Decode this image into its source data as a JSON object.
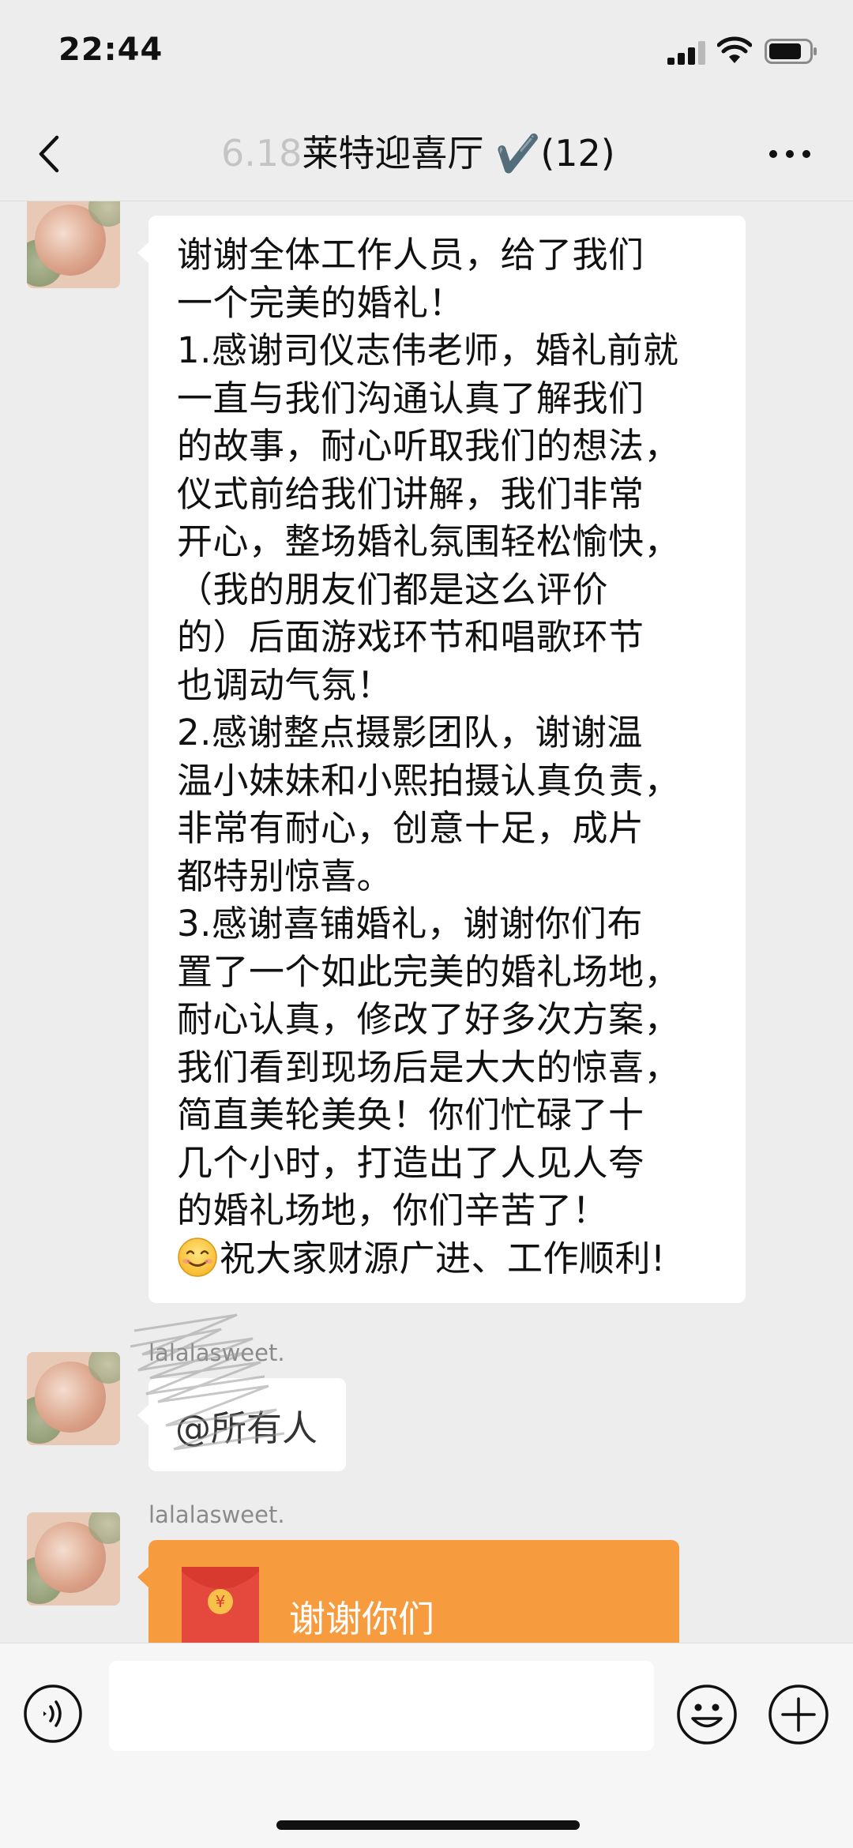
{
  "status_bar": {
    "time": "22:44"
  },
  "header": {
    "title_prefix": "6.18",
    "title_main": "莱特迎喜厅 ✔️(12)",
    "back_icon": "chevron-left-icon",
    "more_icon": "more-dots-icon"
  },
  "messages": [
    {
      "type": "text",
      "lines": [
        "谢谢全体工作人员，给了我们",
        "一个完美的婚礼！",
        "1.感谢司仪志伟老师，婚礼前就",
        "一直与我们沟通认真了解我们",
        "的故事，耐心听取我们的想法，",
        "仪式前给我们讲解，我们非常",
        "开心，整场婚礼氛围轻松愉快，",
        "（我的朋友们都是这么评价",
        "的）后面游戏环节和唱歌环节",
        "也调动气氛！",
        "2.感谢整点摄影团队，谢谢温",
        "温小妹妹和小熙拍摄认真负责，",
        "非常有耐心，创意十足，成片",
        "都特别惊喜。",
        "3.感谢喜铺婚礼，谢谢你们布",
        "置了一个如此完美的婚礼场地，",
        "耐心认真，修改了好多次方案，",
        "我们看到现场后是大大的惊喜，",
        "简直美轮美奂！你们忙碌了十",
        "几个小时，打造出了人见人夸",
        "的婚礼场地，你们辛苦了！"
      ],
      "last_line_emoji": "smiling-face-emoji",
      "last_line_text": "祝大家财源广进、工作顺利!"
    },
    {
      "type": "mention",
      "sender": "lalalasweet.",
      "text": "@所有人"
    },
    {
      "type": "red_packet",
      "sender": "lalalasweet.",
      "text": "谢谢你们",
      "color": "#f79b3f"
    }
  ],
  "input_bar": {
    "voice_icon": "voice-wave-icon",
    "emoji_icon": "emoji-face-icon",
    "plus_icon": "plus-circle-icon",
    "input_value": ""
  },
  "colors": {
    "background": "#ededed",
    "bubble": "#ffffff",
    "red_packet": "#f79b3f",
    "red_packet_icon": "#e5483c"
  }
}
